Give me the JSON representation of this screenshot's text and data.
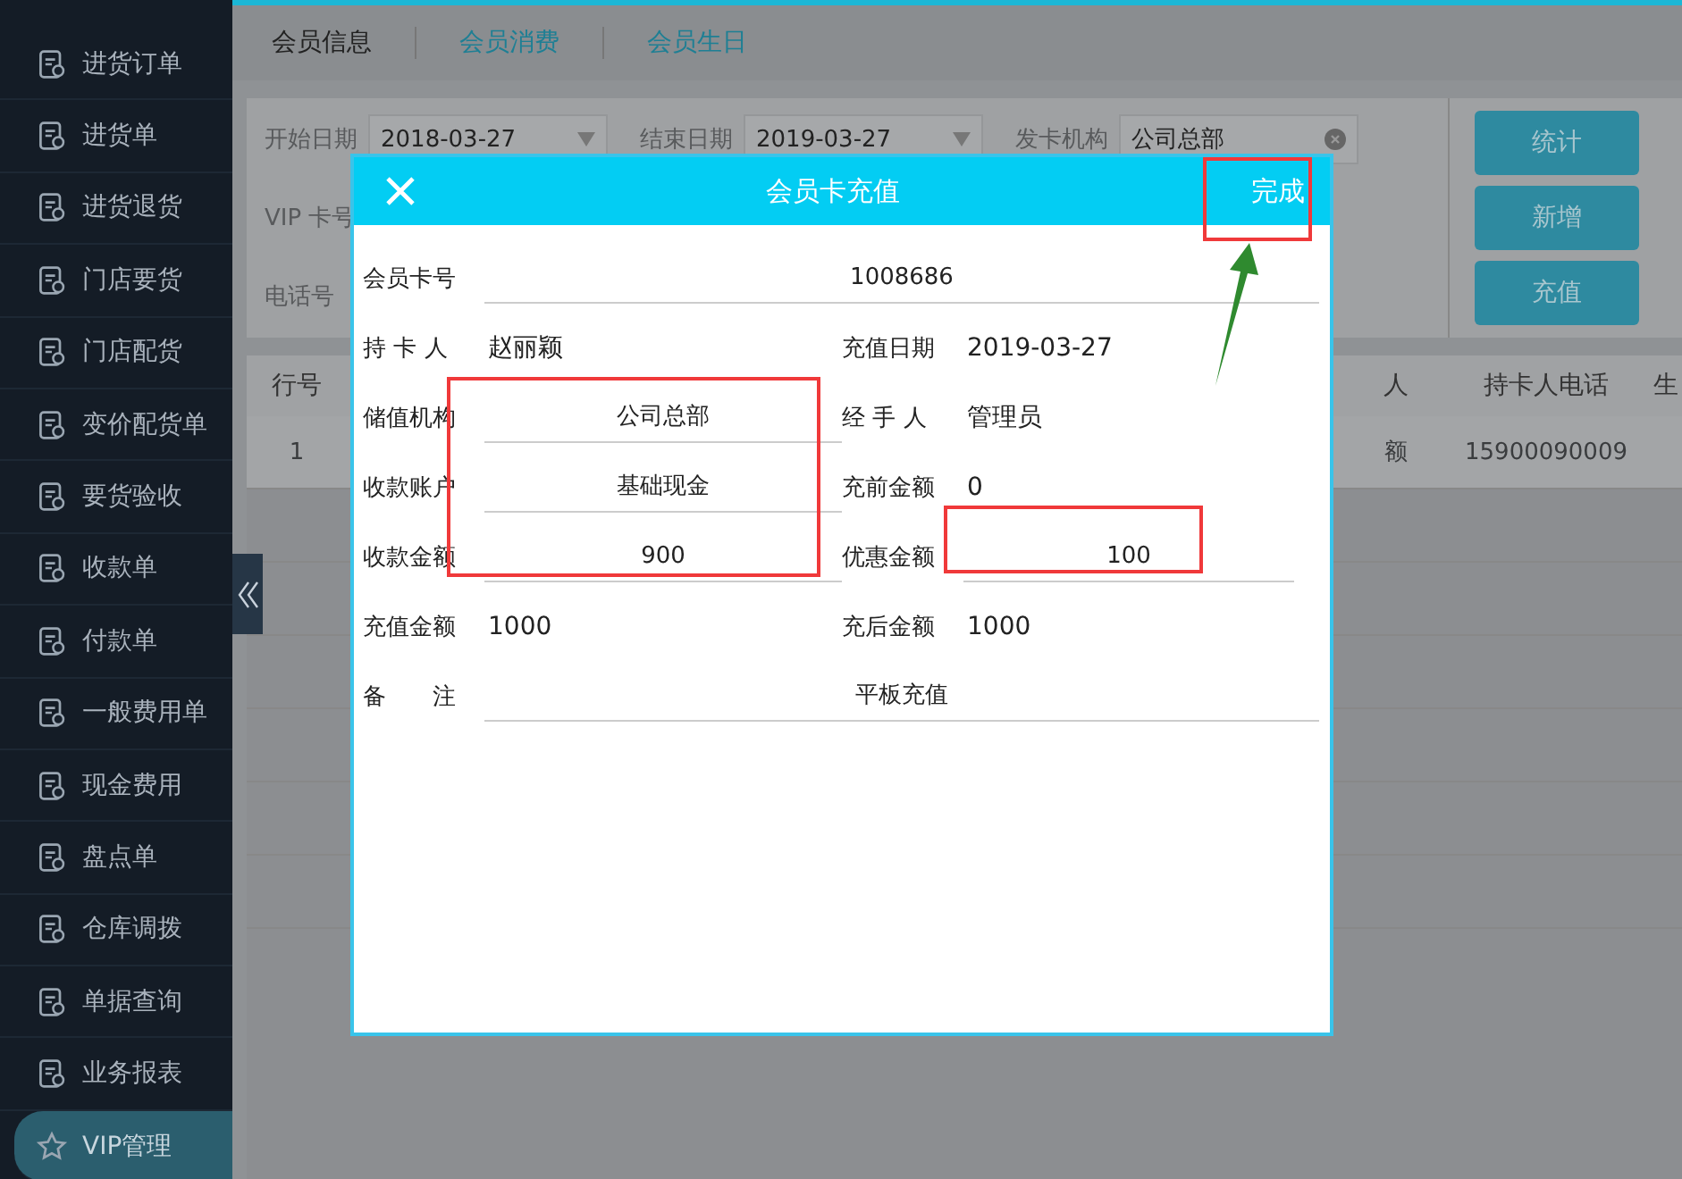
{
  "sidebar": {
    "items": [
      {
        "label": "进货订单",
        "selected": false
      },
      {
        "label": "进货单",
        "selected": false
      },
      {
        "label": "进货退货",
        "selected": false
      },
      {
        "label": "门店要货",
        "selected": false
      },
      {
        "label": "门店配货",
        "selected": false
      },
      {
        "label": "变价配货单",
        "selected": false
      },
      {
        "label": "要货验收",
        "selected": false
      },
      {
        "label": "收款单",
        "selected": false
      },
      {
        "label": "付款单",
        "selected": false
      },
      {
        "label": "一般费用单",
        "selected": false
      },
      {
        "label": "现金费用",
        "selected": false
      },
      {
        "label": "盘点单",
        "selected": false
      },
      {
        "label": "仓库调拨",
        "selected": false
      },
      {
        "label": "单据查询",
        "selected": false
      },
      {
        "label": "业务报表",
        "selected": false
      },
      {
        "label": "VIP管理",
        "selected": true
      }
    ]
  },
  "tabs": [
    {
      "label": "会员信息",
      "selected": true
    },
    {
      "label": "会员消费",
      "selected": false
    },
    {
      "label": "会员生日",
      "selected": false
    }
  ],
  "filters": [
    {
      "label": "开始日期",
      "value": "2018-03-27",
      "kind": "dropdown"
    },
    {
      "label": "结束日期",
      "value": "2019-03-27",
      "kind": "dropdown"
    },
    {
      "label": "发卡机构",
      "value": "公司总部",
      "kind": "clearable"
    },
    {
      "label": "VIP 卡号",
      "kind": "text"
    },
    {
      "label": "电话号",
      "kind": "text"
    }
  ],
  "buttons": [
    "统计",
    "新增",
    "充值"
  ],
  "table": {
    "columns": [
      "行号",
      "人",
      "持卡人电话",
      "生"
    ],
    "rows": [
      [
        "1",
        "额",
        "15900090009"
      ]
    ]
  },
  "dialog": {
    "title": "会员卡充值",
    "done": "完成",
    "fields": [
      {
        "label": "会员卡号",
        "value": "1008686",
        "kind": "wide-input"
      },
      {
        "label": "持 卡 人",
        "value": "赵丽颖",
        "kind": "text"
      },
      {
        "label": "充值日期",
        "value": "2019-03-27",
        "kind": "text"
      },
      {
        "label": "储值机构",
        "value": "公司总部",
        "kind": "input"
      },
      {
        "label": "经 手 人",
        "value": "管理员",
        "kind": "text"
      },
      {
        "label": "收款账户",
        "value": "基础现金",
        "kind": "input"
      },
      {
        "label": "充前金额",
        "value": "0",
        "kind": "text"
      },
      {
        "label": "收款金额",
        "value": "900",
        "kind": "input"
      },
      {
        "label": "优惠金额",
        "value": "100",
        "kind": "input"
      },
      {
        "label": "充值金额",
        "value": "1000",
        "kind": "text"
      },
      {
        "label": "充后金额",
        "value": "1000",
        "kind": "text"
      },
      {
        "label": "备　　注",
        "value": "平板充值",
        "kind": "wide-input"
      }
    ]
  }
}
